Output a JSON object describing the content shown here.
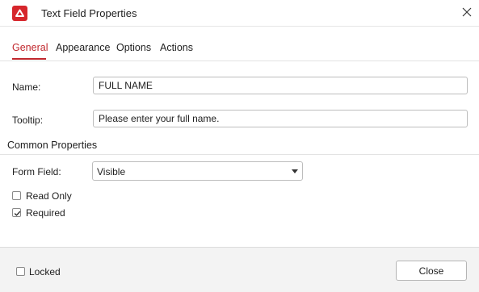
{
  "window": {
    "title": "Text Field Properties",
    "app_icon": "pdf-app-icon",
    "close_icon": "close-icon"
  },
  "tabs": [
    {
      "label": "General",
      "active": true
    },
    {
      "label": "Appearance",
      "active": false
    },
    {
      "label": "Options",
      "active": false
    },
    {
      "label": "Actions",
      "active": false
    }
  ],
  "general": {
    "name_label": "Name:",
    "name_value": "FULL NAME",
    "tooltip_label": "Tooltip:",
    "tooltip_value": "Please enter your full name."
  },
  "common": {
    "section_title": "Common Properties",
    "form_field_label": "Form Field:",
    "form_field_value": "Visible",
    "read_only_label": "Read Only",
    "read_only_checked": false,
    "required_label": "Required",
    "required_checked": true
  },
  "footer": {
    "locked_label": "Locked",
    "locked_checked": false,
    "close_label": "Close"
  },
  "colors": {
    "accent": "#c1272d",
    "app_icon_bg": "#d6262c"
  }
}
